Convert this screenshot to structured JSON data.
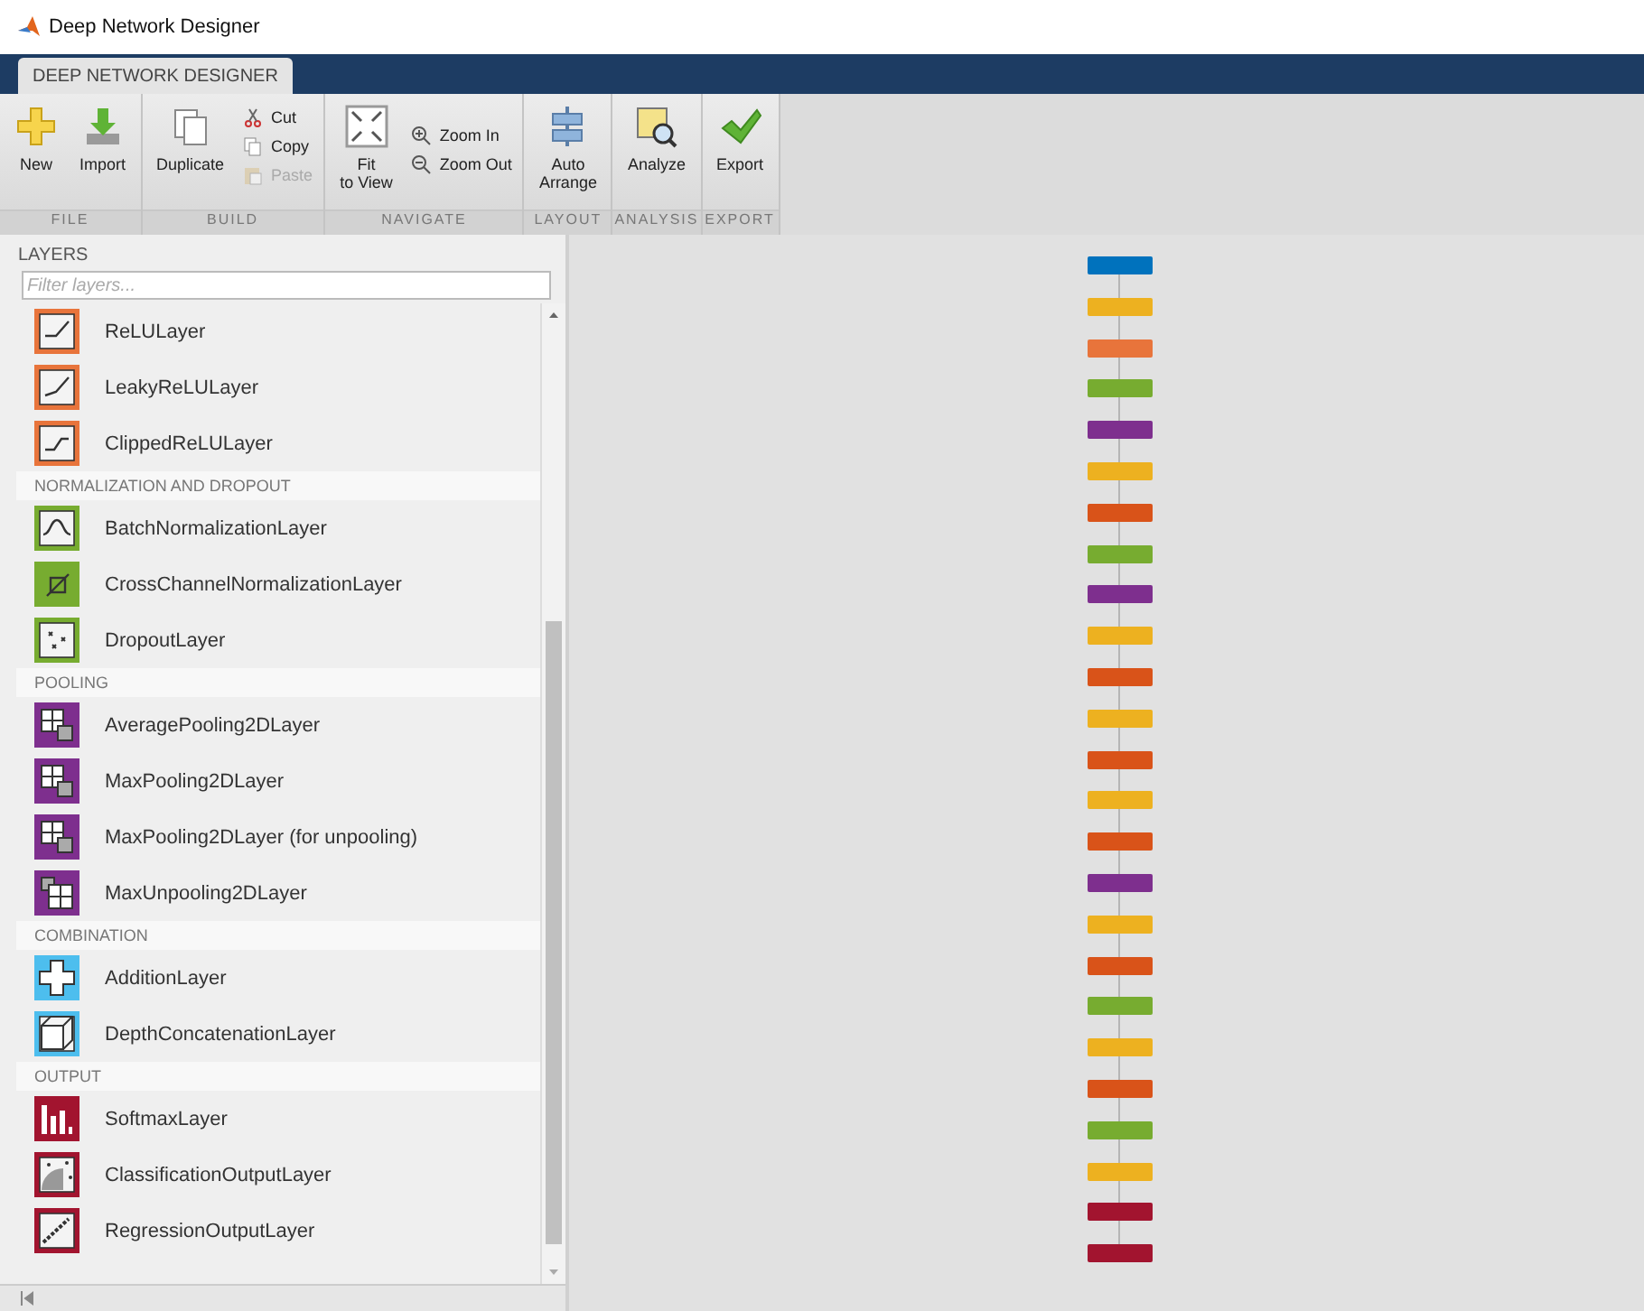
{
  "window": {
    "title": "Deep Network Designer"
  },
  "tabs": [
    {
      "label": "DEEP NETWORK DESIGNER",
      "selected": true
    }
  ],
  "toolstrip": [
    {
      "group": "FILE",
      "kind": "large",
      "buttons": [
        {
          "label": "New",
          "kind": "plus"
        },
        {
          "label": "Import",
          "kind": "import"
        }
      ]
    },
    {
      "group": "BUILD",
      "kind": "build",
      "buttons": [
        {
          "label": "Duplicate",
          "kind": "duplicate"
        }
      ],
      "small": [
        {
          "label": "Cut",
          "kind": "cut",
          "disabled": false
        },
        {
          "label": "Copy",
          "kind": "copy",
          "disabled": false
        },
        {
          "label": "Paste",
          "kind": "paste",
          "disabled": true
        }
      ]
    },
    {
      "group": "NAVIGATE",
      "kind": "navigate",
      "buttons": [
        {
          "label": "Fit\nto View",
          "kind": "fit"
        }
      ],
      "small": [
        {
          "label": "Zoom In",
          "kind": "zoomin",
          "disabled": false
        },
        {
          "label": "Zoom Out",
          "kind": "zoomout",
          "disabled": false
        }
      ]
    },
    {
      "group": "LAYOUT",
      "kind": "large",
      "buttons": [
        {
          "label": "Auto\nArrange",
          "kind": "arrange"
        }
      ]
    },
    {
      "group": "ANALYSIS",
      "kind": "large",
      "buttons": [
        {
          "label": "Analyze",
          "kind": "analyze"
        }
      ]
    },
    {
      "group": "EXPORT",
      "kind": "large",
      "buttons": [
        {
          "label": "Export",
          "kind": "check"
        }
      ]
    }
  ],
  "layers_panel": {
    "title": "LAYERS",
    "filter": {
      "placeholder": "Filter layers..."
    },
    "sections": [
      {
        "items": [
          {
            "name": "ReLULayer",
            "kind": "relu",
            "color": "#e8743b"
          },
          {
            "name": "LeakyReLULayer",
            "kind": "leaky",
            "color": "#e8743b"
          },
          {
            "name": "ClippedReLULayer",
            "kind": "clipped",
            "color": "#e8743b"
          }
        ]
      },
      {
        "title": "NORMALIZATION AND DROPOUT",
        "items": [
          {
            "name": "BatchNormalizationLayer",
            "kind": "bell",
            "color": "#77ac30"
          },
          {
            "name": "CrossChannelNormalizationLayer",
            "kind": "cross",
            "color": "#77ac30"
          },
          {
            "name": "DropoutLayer",
            "kind": "dropout",
            "color": "#77ac30"
          }
        ]
      },
      {
        "title": "POOLING",
        "items": [
          {
            "name": "AveragePooling2DLayer",
            "kind": "pool",
            "color": "#7e2f8e"
          },
          {
            "name": "MaxPooling2DLayer",
            "kind": "pool",
            "color": "#7e2f8e"
          },
          {
            "name": "MaxPooling2DLayer (for unpooling)",
            "kind": "pool",
            "color": "#7e2f8e"
          },
          {
            "name": "MaxUnpooling2DLayer",
            "kind": "unpool",
            "color": "#7e2f8e"
          }
        ]
      },
      {
        "title": "COMBINATION",
        "items": [
          {
            "name": "AdditionLayer",
            "kind": "add",
            "color": "#4dbeee"
          },
          {
            "name": "DepthConcatenationLayer",
            "kind": "cube",
            "color": "#4dbeee"
          }
        ]
      },
      {
        "title": "OUTPUT",
        "items": [
          {
            "name": "SoftmaxLayer",
            "kind": "bars",
            "color": "#a2142f"
          },
          {
            "name": "ClassificationOutputLayer",
            "kind": "dots",
            "color": "#a2142f"
          },
          {
            "name": "RegressionOutputLayer",
            "kind": "line",
            "color": "#a2142f"
          }
        ]
      }
    ]
  },
  "canvas": {
    "nodes": [
      {
        "color": "#0072bd"
      },
      {
        "color": "#edb120"
      },
      {
        "color": "#e8743b"
      },
      {
        "color": "#77ac30"
      },
      {
        "color": "#7e2f8e"
      },
      {
        "color": "#edb120"
      },
      {
        "color": "#d95319"
      },
      {
        "color": "#77ac30"
      },
      {
        "color": "#7e2f8e"
      },
      {
        "color": "#edb120"
      },
      {
        "color": "#d95319"
      },
      {
        "color": "#edb120"
      },
      {
        "color": "#d95319"
      },
      {
        "color": "#edb120"
      },
      {
        "color": "#d95319"
      },
      {
        "color": "#7e2f8e"
      },
      {
        "color": "#edb120"
      },
      {
        "color": "#d95319"
      },
      {
        "color": "#77ac30"
      },
      {
        "color": "#edb120"
      },
      {
        "color": "#d95319"
      },
      {
        "color": "#77ac30"
      },
      {
        "color": "#edb120"
      },
      {
        "color": "#a2142f"
      },
      {
        "color": "#a2142f"
      }
    ]
  }
}
